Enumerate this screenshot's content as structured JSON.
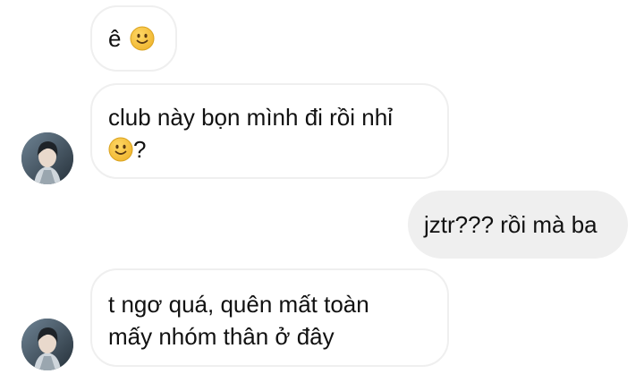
{
  "messages": [
    {
      "side": "incoming",
      "lines": [
        "ê"
      ],
      "emoji": "slightly-smiling-face-emoji"
    },
    {
      "side": "incoming",
      "lines": [
        "club này bọn mình đi rồi nhỉ",
        "?"
      ],
      "emoji": "slightly-smiling-face-emoji"
    },
    {
      "side": "outgoing",
      "lines": [
        "jztr??? rồi mà ba"
      ]
    },
    {
      "side": "incoming",
      "lines": [
        "t ngơ quá, quên mất toàn",
        "mấy nhóm thân ở đây"
      ]
    }
  ],
  "colors": {
    "incoming_bg": "#ffffff",
    "incoming_border": "#efefef",
    "outgoing_bg": "#efefef",
    "text": "#111111",
    "emoji_face": "#f5c242"
  },
  "icons": {
    "emoji": "slightly-smiling-face-emoji",
    "avatar": "contact-avatar"
  }
}
